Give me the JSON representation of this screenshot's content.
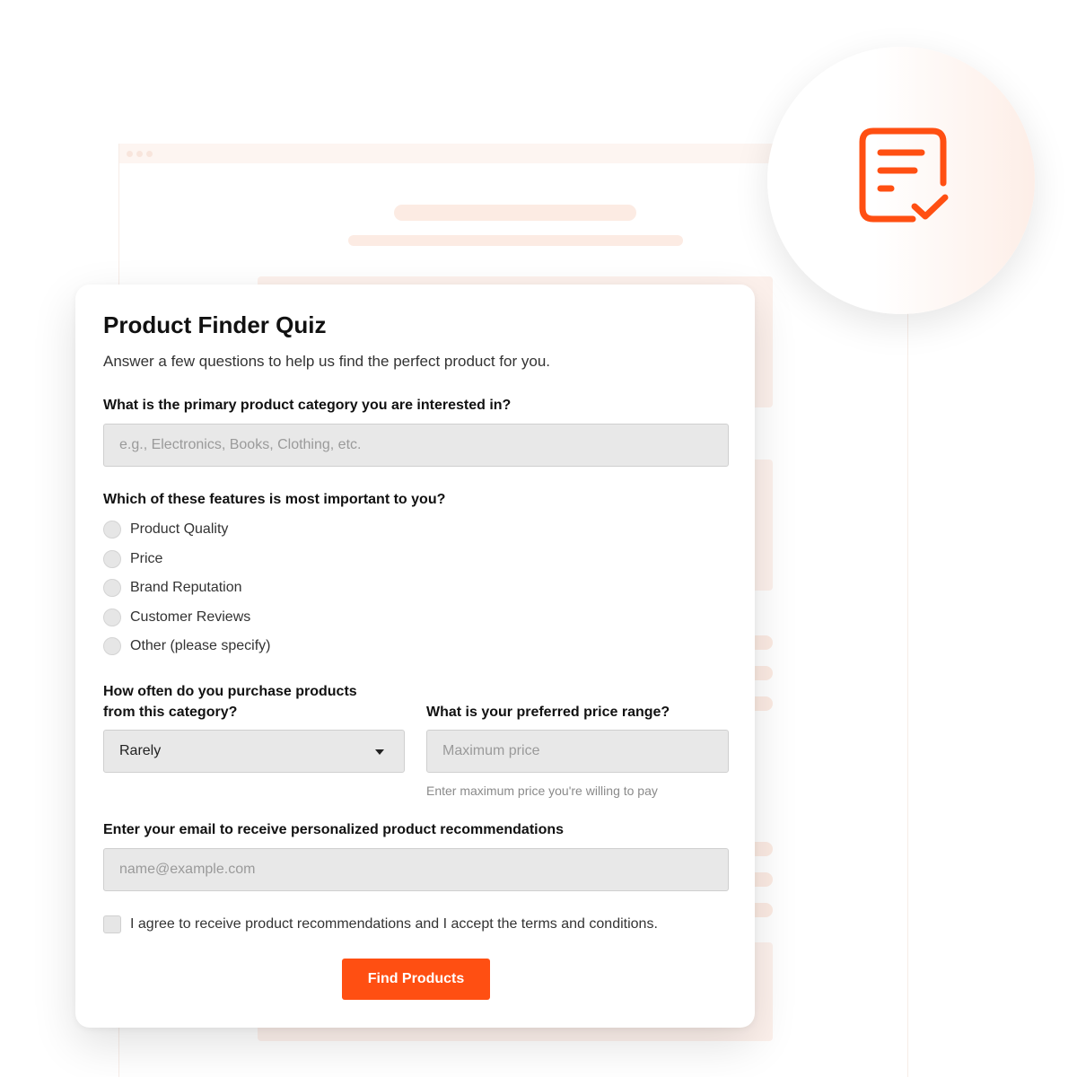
{
  "quiz": {
    "title": "Product Finder Quiz",
    "subtitle": "Answer a few questions to help us find the perfect product for you.",
    "category": {
      "label": "What is the primary product category you are interested in?",
      "placeholder": "e.g., Electronics, Books, Clothing, etc."
    },
    "features": {
      "label": "Which of these features is most important to you?",
      "options": [
        "Product Quality",
        "Price",
        "Brand Reputation",
        "Customer Reviews",
        "Other (please specify)"
      ]
    },
    "frequency": {
      "label_line1": "How often do you purchase products",
      "label_line2": "from this category?",
      "selected": "Rarely"
    },
    "price": {
      "label": "What is your preferred price range?",
      "placeholder": "Maximum price",
      "helper": "Enter maximum price you're willing to pay"
    },
    "email": {
      "label": "Enter your email to receive personalized product recommendations",
      "placeholder": "name@example.com"
    },
    "agree_label": "I agree to receive product recommendations and I accept the terms and conditions.",
    "submit_label": "Find Products"
  },
  "colors": {
    "accent": "#ff4f12",
    "input_bg": "#e8e8e8"
  },
  "icons": {
    "badge": "checklist-document-icon"
  }
}
